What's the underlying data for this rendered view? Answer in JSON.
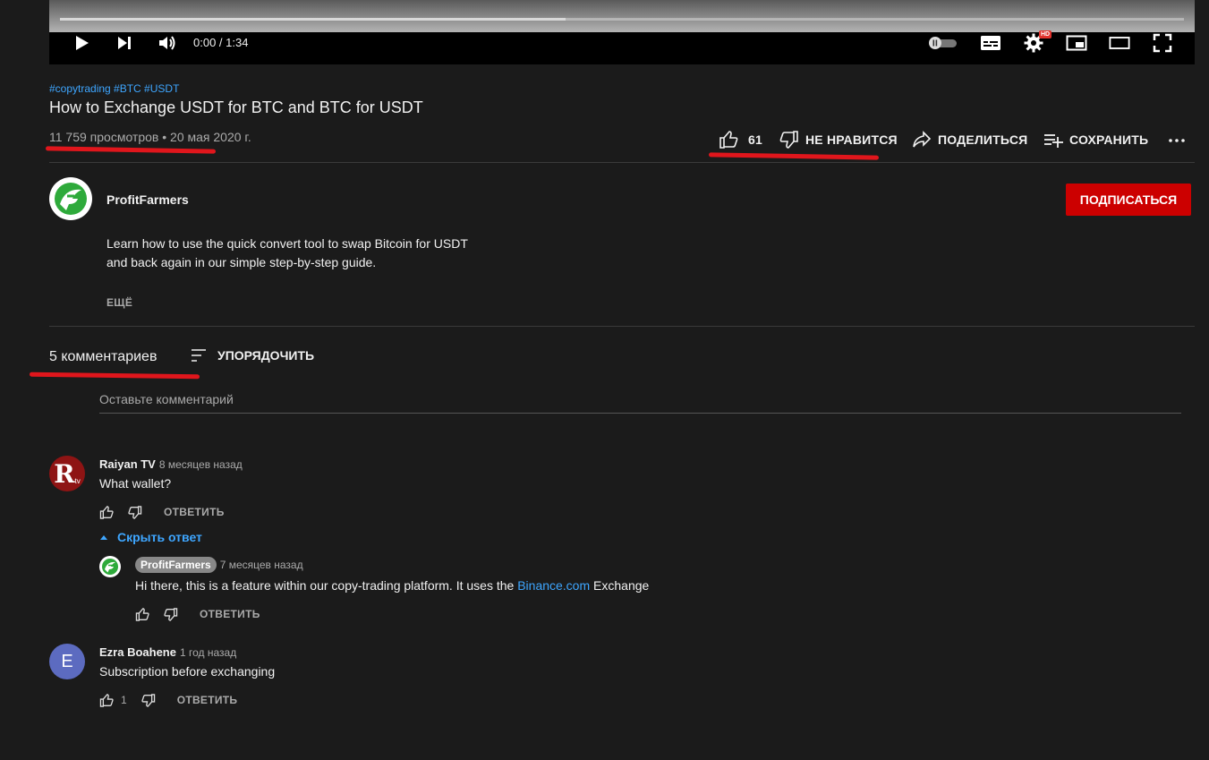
{
  "player": {
    "time": "0:00 / 1:34",
    "progress": 0.45,
    "hd_badge": "HD"
  },
  "video": {
    "hashtags": "#copytrading #BTC #USDT",
    "title": "How to Exchange USDT for BTC and BTC for USDT",
    "views": "11 759 просмотров",
    "separator": "•",
    "date": "20 мая 2020 г.",
    "likes": "61",
    "dislike_label": "НЕ НРАВИТСЯ",
    "share_label": "ПОДЕЛИТЬСЯ",
    "save_label": "СОХРАНИТЬ"
  },
  "channel": {
    "name": "ProfitFarmers",
    "subscribe_label": "ПОДПИСАТЬСЯ",
    "description_line1": "Learn how to use the quick convert tool to swap Bitcoin for USDT",
    "description_line2": "and back again in our simple step-by-step guide.",
    "more_label": "ЕЩЁ"
  },
  "comments_header": {
    "count": "5 комментариев",
    "sort_label": "УПОРЯДОЧИТЬ",
    "placeholder": "Оставьте комментарий"
  },
  "comments": [
    {
      "author": "Raiyan TV",
      "age": "8 месяцев назад",
      "text": "What wallet?",
      "reply_label": "ОТВЕТИТЬ",
      "avatar_letter": "R",
      "avatar_sub": "tv",
      "hide_replies": "Скрыть ответ",
      "reply": {
        "author": "ProfitFarmers",
        "age": "7 месяцев назад",
        "text_before": "Hi there, this is a feature within our copy-trading platform. It uses the ",
        "link": "Binance.com",
        "text_after": " Exchange",
        "reply_label": "ОТВЕТИТЬ"
      }
    },
    {
      "author": "Ezra Boahene",
      "age": "1 год назад",
      "text": "Subscription before exchanging",
      "likes": "1",
      "reply_label": "ОТВЕТИТЬ",
      "avatar_letter": "E"
    }
  ],
  "colors": {
    "background": "#1b1b1b",
    "accent_red": "#cc0000",
    "link_blue": "#3ea6ff",
    "annotation_red": "#e0161c"
  }
}
